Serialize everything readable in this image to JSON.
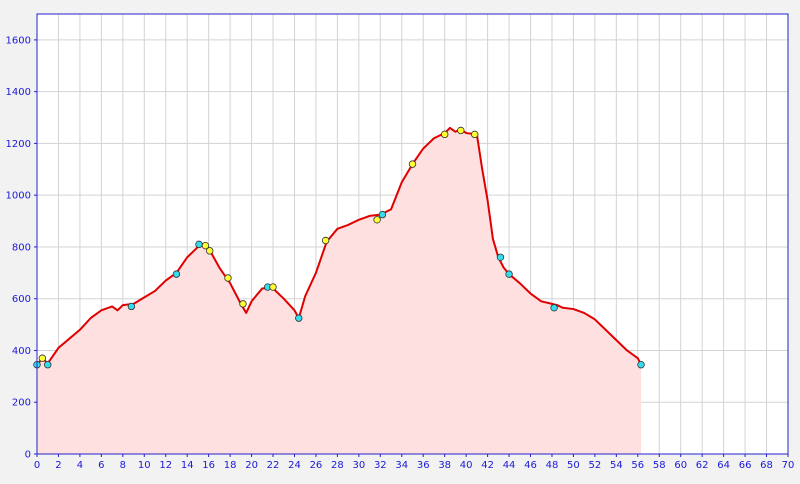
{
  "chart_data": {
    "type": "area",
    "title": "",
    "xlabel": "",
    "ylabel": "",
    "xlim": [
      0,
      70
    ],
    "ylim": [
      0,
      1700
    ],
    "x_ticks": [
      0,
      2,
      4,
      6,
      8,
      10,
      12,
      14,
      16,
      18,
      20,
      22,
      24,
      26,
      28,
      30,
      32,
      34,
      36,
      38,
      40,
      42,
      44,
      46,
      48,
      50,
      52,
      54,
      56,
      58,
      60,
      62,
      64,
      66,
      68,
      70
    ],
    "y_ticks": [
      0,
      200,
      400,
      600,
      800,
      1000,
      1200,
      1400,
      1600
    ],
    "grid": true,
    "colors": {
      "plot_background": "#ffffff",
      "page_background": "#f2f2f2",
      "frame": "#2222cc",
      "grid": "#d3d3d3",
      "line": "#e00000",
      "fill": "#ffe0e0",
      "tick_label": "#1a1ad6",
      "marker_yellow": "#ffff33",
      "marker_cyan": "#33ddee"
    },
    "series": [
      {
        "x": [
          0,
          0.5,
          1,
          2,
          3,
          4,
          5,
          6,
          7,
          7.5,
          8,
          9,
          10,
          11,
          12,
          13,
          14,
          15,
          15.5,
          16,
          17,
          18,
          19,
          19.5,
          20,
          21,
          22,
          23,
          24,
          24.4,
          25,
          26,
          27,
          28,
          29,
          30,
          31,
          32,
          33,
          34,
          35,
          36,
          37,
          38,
          38.5,
          39,
          39.5,
          40,
          41,
          41.5,
          42,
          42.5,
          43,
          43.5,
          44,
          45,
          46,
          47,
          48,
          48.5,
          49,
          50,
          51,
          52,
          53,
          54,
          55,
          56,
          56.3
        ],
        "values": [
          345,
          370,
          350,
          410,
          445,
          480,
          525,
          555,
          570,
          555,
          575,
          580,
          605,
          630,
          670,
          700,
          760,
          800,
          810,
          795,
          720,
          660,
          580,
          545,
          590,
          640,
          640,
          600,
          555,
          525,
          610,
          700,
          820,
          870,
          885,
          905,
          920,
          925,
          945,
          1050,
          1120,
          1180,
          1220,
          1240,
          1260,
          1245,
          1255,
          1240,
          1235,
          1100,
          980,
          830,
          760,
          720,
          695,
          660,
          620,
          590,
          580,
          575,
          565,
          560,
          545,
          520,
          480,
          440,
          400,
          370,
          345
        ]
      }
    ],
    "markers": [
      {
        "x": 0,
        "y": 345,
        "color": "cyan"
      },
      {
        "x": 0.5,
        "y": 370,
        "color": "yellow"
      },
      {
        "x": 1,
        "y": 345,
        "color": "cyan"
      },
      {
        "x": 8.8,
        "y": 570,
        "color": "cyan"
      },
      {
        "x": 13,
        "y": 695,
        "color": "cyan"
      },
      {
        "x": 15.1,
        "y": 810,
        "color": "cyan"
      },
      {
        "x": 15.7,
        "y": 805,
        "color": "yellow"
      },
      {
        "x": 16.1,
        "y": 785,
        "color": "yellow"
      },
      {
        "x": 17.8,
        "y": 680,
        "color": "yellow"
      },
      {
        "x": 19.2,
        "y": 580,
        "color": "yellow"
      },
      {
        "x": 21.5,
        "y": 645,
        "color": "cyan"
      },
      {
        "x": 22,
        "y": 645,
        "color": "yellow"
      },
      {
        "x": 24.4,
        "y": 525,
        "color": "cyan"
      },
      {
        "x": 26.9,
        "y": 825,
        "color": "yellow"
      },
      {
        "x": 31.7,
        "y": 905,
        "color": "yellow"
      },
      {
        "x": 32.2,
        "y": 925,
        "color": "cyan"
      },
      {
        "x": 35,
        "y": 1120,
        "color": "yellow"
      },
      {
        "x": 38,
        "y": 1235,
        "color": "yellow"
      },
      {
        "x": 39.5,
        "y": 1250,
        "color": "yellow"
      },
      {
        "x": 40.8,
        "y": 1235,
        "color": "yellow"
      },
      {
        "x": 43.2,
        "y": 760,
        "color": "cyan"
      },
      {
        "x": 44,
        "y": 695,
        "color": "cyan"
      },
      {
        "x": 48.2,
        "y": 565,
        "color": "cyan"
      },
      {
        "x": 56.3,
        "y": 345,
        "color": "cyan"
      }
    ]
  }
}
